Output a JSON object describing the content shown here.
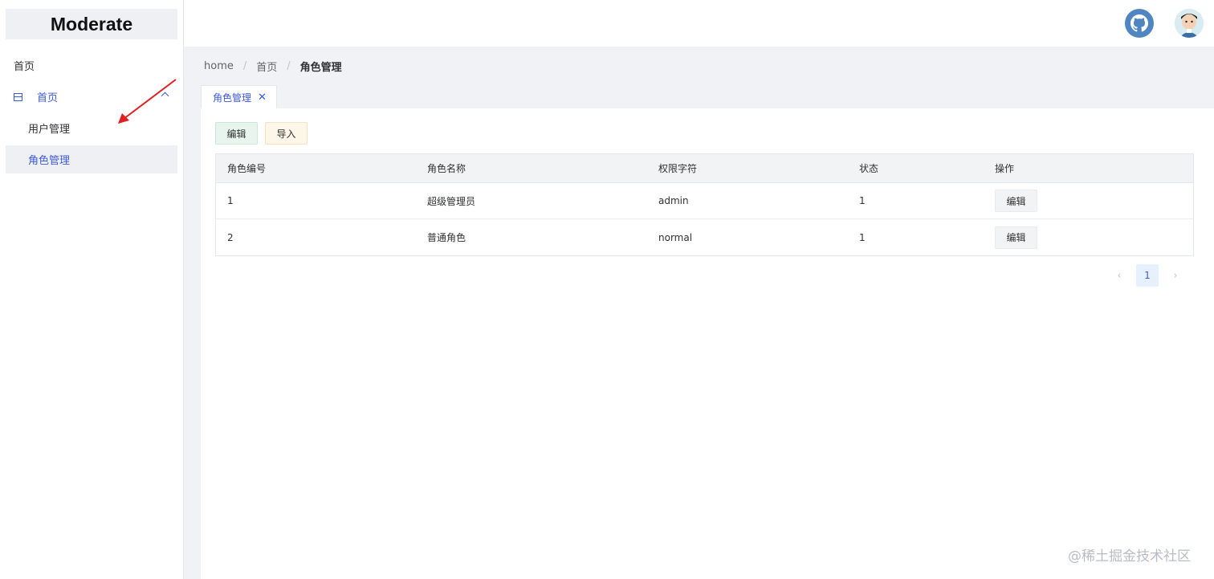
{
  "app": {
    "title": "Moderate"
  },
  "sidebar": {
    "items": [
      {
        "label": "首页"
      },
      {
        "label": "首页"
      },
      {
        "label": "用户管理"
      },
      {
        "label": "角色管理"
      }
    ]
  },
  "breadcrumb": {
    "items": [
      "home",
      "首页",
      "角色管理"
    ],
    "separator": "/"
  },
  "tabs": [
    {
      "label": "角色管理",
      "close": "✕"
    }
  ],
  "toolbar": {
    "edit_label": "编辑",
    "import_label": "导入"
  },
  "table": {
    "columns": [
      "角色编号",
      "角色名称",
      "权限字符",
      "状态",
      "操作"
    ],
    "rows": [
      {
        "id": "1",
        "name": "超级管理员",
        "key": "admin",
        "status": "1",
        "action": "编辑"
      },
      {
        "id": "2",
        "name": "普通角色",
        "key": "normal",
        "status": "1",
        "action": "编辑"
      }
    ]
  },
  "pagination": {
    "current": "1",
    "prev": "‹",
    "next": "›"
  },
  "watermark": "@稀土掘金技术社区",
  "colors": {
    "accent": "#3c5ae0",
    "arrow": "#e02020",
    "github": "#4f86c2"
  }
}
